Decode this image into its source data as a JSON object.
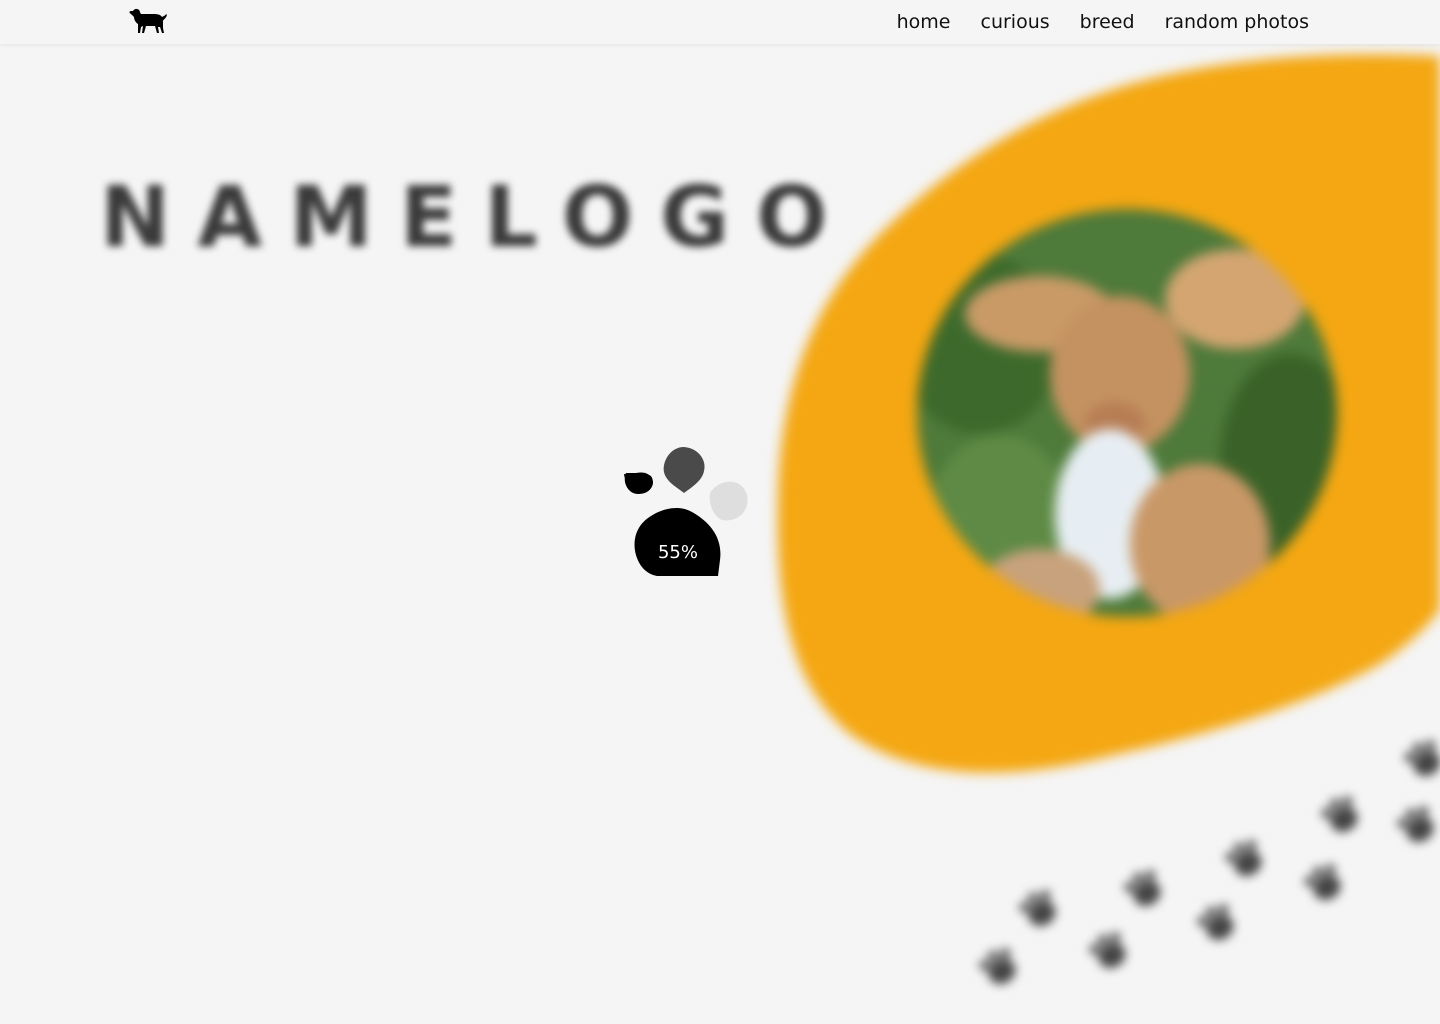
{
  "nav": {
    "logo_icon": "dog-icon",
    "links": [
      {
        "label": "home"
      },
      {
        "label": "curious"
      },
      {
        "label": "breed"
      },
      {
        "label": "random photos"
      }
    ]
  },
  "hero": {
    "brand_title": "NAMELOGO",
    "accent_color": "#f4a712",
    "photo": "dog-photo"
  },
  "loader": {
    "progress_label": "55%",
    "progress_value": 55,
    "icon": "paw-icon"
  }
}
